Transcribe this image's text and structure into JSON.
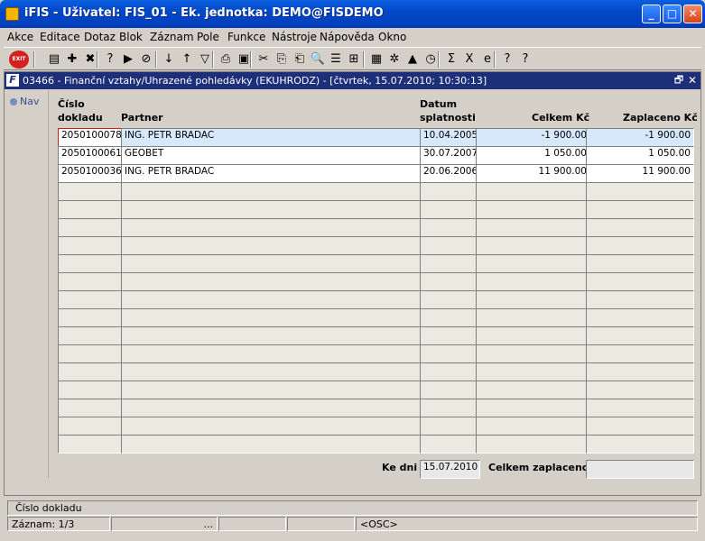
{
  "window": {
    "title": "iFIS - Uživatel: FIS_01 - Ek. jednotka: DEMO@FISDEMO",
    "min": "_",
    "max": "□",
    "close": "✕"
  },
  "menu": [
    "Akce",
    "Editace",
    "Dotaz",
    "Blok",
    "Záznam",
    "Pole",
    "Funkce",
    "Nástroje",
    "Nápověda",
    "Okno"
  ],
  "toolbar": {
    "exit_label": "EXIT",
    "icons": [
      "save-icon",
      "insert-record-icon",
      "delete-record-icon",
      "query-icon",
      "execute-query-icon",
      "cancel-query-icon",
      "sort-asc-icon",
      "sort-desc-icon",
      "filter-icon",
      "print-icon",
      "print-preview-icon",
      "cut-icon",
      "copy-icon",
      "paste-icon",
      "find-icon",
      "list-icon",
      "split-icon",
      "calculator-icon",
      "tools-icon",
      "warning-icon",
      "clock-icon",
      "sum-icon",
      "excel-icon",
      "browser-icon",
      "help-icon",
      "context-help-icon"
    ],
    "glyphs": [
      "▤",
      "✚",
      "✖",
      "?",
      "▶",
      "⊘",
      "↓",
      "↑",
      "▽",
      "⎙",
      "▣",
      "✂",
      "⎘",
      "⎗",
      "🔍",
      "☰",
      "⊞",
      "▦",
      "✲",
      "▲",
      "◷",
      "Σ",
      "X",
      "e",
      "?",
      "?"
    ]
  },
  "form": {
    "title": "03466 - Finanční vztahy/Uhrazené pohledávky (EKUHRODZ) - [čtvrtek, 15.07.2010; 10:30:13]",
    "restore": "🗗",
    "close": "✕",
    "nav_label": "Nav",
    "columns": {
      "doc_line1": "Číslo",
      "doc_line2": "dokladu",
      "partner": "Partner",
      "due_line1": "Datum",
      "due_line2": "splatnosti",
      "total": "Celkem Kč",
      "paid": "Zaplaceno Kč"
    },
    "rows": [
      {
        "doc": "2050100078",
        "partner": "ING. PETR BRADAC",
        "due": "10.04.2005",
        "total": "-1 900.00",
        "paid": "-1 900.00"
      },
      {
        "doc": "2050100061",
        "partner": "GEOBET",
        "due": "30.07.2007",
        "total": "1 050.00",
        "paid": "1 050.00"
      },
      {
        "doc": "2050100036",
        "partner": "ING. PETR BRADAC",
        "due": "20.06.2006",
        "total": "11 900.00",
        "paid": "11 900.00"
      }
    ],
    "empty_rows": 15,
    "footer": {
      "ke_dni_label": "Ke dni",
      "ke_dni_value": "15.07.2010",
      "total_paid_label": "Celkem zaplaceno",
      "total_paid_value": ""
    }
  },
  "status": {
    "hint": "Číslo dokladu",
    "record": "Záznam: 1/3",
    "ellipsis": "...",
    "mode": "<OSC>"
  }
}
